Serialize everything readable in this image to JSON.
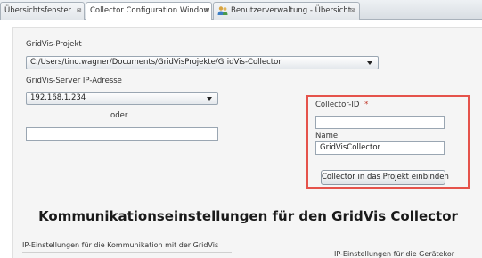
{
  "tabs": [
    {
      "label": "Übersichtsfenster",
      "close": "⊠",
      "active": false
    },
    {
      "label": "Collector Configuration Window",
      "close": "⊠",
      "active": true
    },
    {
      "label": "Benutzerverwaltung - Übersicht",
      "close": "⊠",
      "active": false,
      "icon": "users-icon"
    }
  ],
  "form": {
    "project_label": "GridVis-Projekt",
    "project_value": "C:/Users/tino.wagner/Documents/GridVisProjekte/GridVis-Collector",
    "server_label": "GridVis-Server IP-Adresse",
    "server_value": "192.168.1.234",
    "or_label": "oder",
    "alt_value": "",
    "collector_id_label": "Collector-ID",
    "required_mark": "*",
    "collector_id_value": "",
    "name_label": "Name",
    "name_value": "GridVisCollector",
    "embed_button": "Collector in das Projekt einbinden"
  },
  "section": {
    "heading": "Kommunikationseinstellungen für den GridVis Collector",
    "left_group_label": "IP-Einstellungen für die Kommunikation mit der GridVis",
    "right_group_label": "IP-Einstellungen für die Gerätekor"
  },
  "colors": {
    "highlight": "#e5534b",
    "panel_bg": "#f5f5f5"
  }
}
